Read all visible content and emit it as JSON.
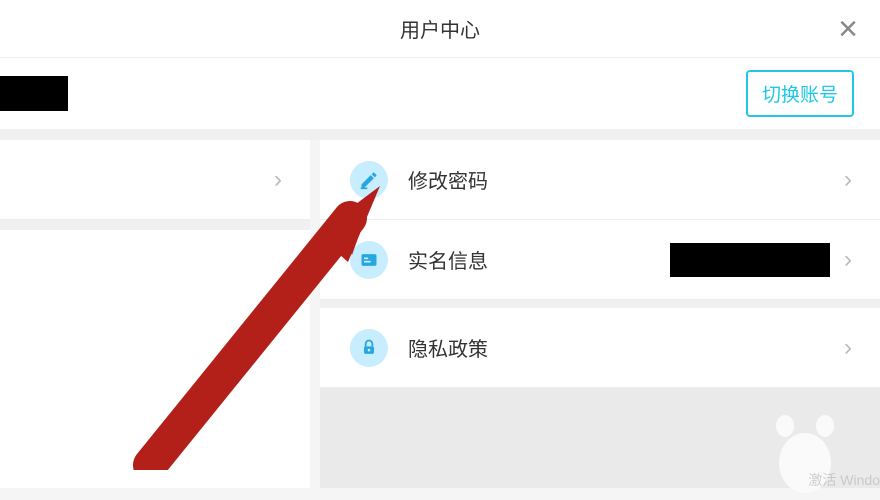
{
  "header": {
    "title": "用户中心",
    "close_label": "×"
  },
  "account": {
    "switch_label": "切换账号"
  },
  "menu": {
    "change_password": {
      "label": "修改密码",
      "icon": "pencil-icon"
    },
    "realname_info": {
      "label": "实名信息",
      "icon": "id-card-icon"
    },
    "privacy_policy": {
      "label": "隐私政策",
      "icon": "lock-icon"
    }
  },
  "colors": {
    "accent": "#1ec8e6",
    "icon_bg": "#c8edff",
    "icon_fg": "#28a6e0"
  },
  "watermark": "激活 Windo"
}
